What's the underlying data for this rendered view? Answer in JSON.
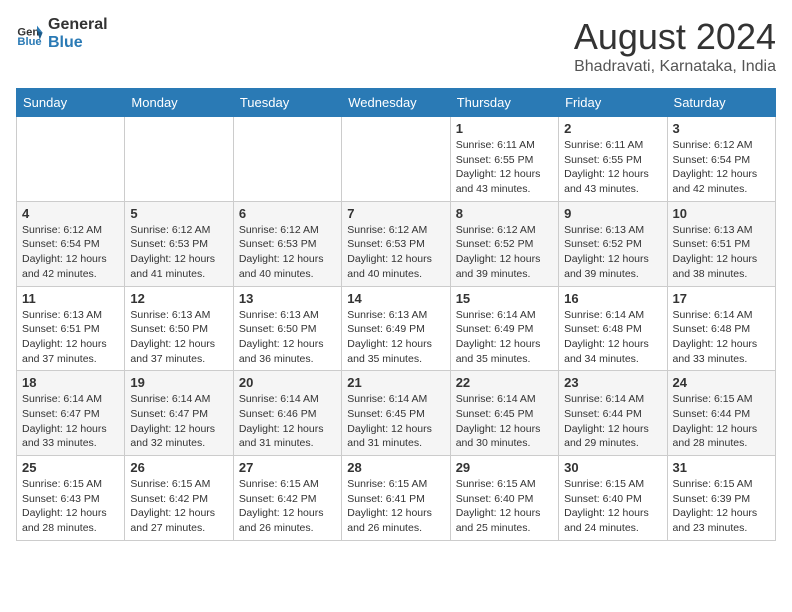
{
  "header": {
    "logo_line1": "General",
    "logo_line2": "Blue",
    "main_title": "August 2024",
    "subtitle": "Bhadravati, Karnataka, India"
  },
  "days_of_week": [
    "Sunday",
    "Monday",
    "Tuesday",
    "Wednesday",
    "Thursday",
    "Friday",
    "Saturday"
  ],
  "weeks": [
    [
      {
        "day": "",
        "info": ""
      },
      {
        "day": "",
        "info": ""
      },
      {
        "day": "",
        "info": ""
      },
      {
        "day": "",
        "info": ""
      },
      {
        "day": "1",
        "info": "Sunrise: 6:11 AM\nSunset: 6:55 PM\nDaylight: 12 hours\nand 43 minutes."
      },
      {
        "day": "2",
        "info": "Sunrise: 6:11 AM\nSunset: 6:55 PM\nDaylight: 12 hours\nand 43 minutes."
      },
      {
        "day": "3",
        "info": "Sunrise: 6:12 AM\nSunset: 6:54 PM\nDaylight: 12 hours\nand 42 minutes."
      }
    ],
    [
      {
        "day": "4",
        "info": "Sunrise: 6:12 AM\nSunset: 6:54 PM\nDaylight: 12 hours\nand 42 minutes."
      },
      {
        "day": "5",
        "info": "Sunrise: 6:12 AM\nSunset: 6:53 PM\nDaylight: 12 hours\nand 41 minutes."
      },
      {
        "day": "6",
        "info": "Sunrise: 6:12 AM\nSunset: 6:53 PM\nDaylight: 12 hours\nand 40 minutes."
      },
      {
        "day": "7",
        "info": "Sunrise: 6:12 AM\nSunset: 6:53 PM\nDaylight: 12 hours\nand 40 minutes."
      },
      {
        "day": "8",
        "info": "Sunrise: 6:12 AM\nSunset: 6:52 PM\nDaylight: 12 hours\nand 39 minutes."
      },
      {
        "day": "9",
        "info": "Sunrise: 6:13 AM\nSunset: 6:52 PM\nDaylight: 12 hours\nand 39 minutes."
      },
      {
        "day": "10",
        "info": "Sunrise: 6:13 AM\nSunset: 6:51 PM\nDaylight: 12 hours\nand 38 minutes."
      }
    ],
    [
      {
        "day": "11",
        "info": "Sunrise: 6:13 AM\nSunset: 6:51 PM\nDaylight: 12 hours\nand 37 minutes."
      },
      {
        "day": "12",
        "info": "Sunrise: 6:13 AM\nSunset: 6:50 PM\nDaylight: 12 hours\nand 37 minutes."
      },
      {
        "day": "13",
        "info": "Sunrise: 6:13 AM\nSunset: 6:50 PM\nDaylight: 12 hours\nand 36 minutes."
      },
      {
        "day": "14",
        "info": "Sunrise: 6:13 AM\nSunset: 6:49 PM\nDaylight: 12 hours\nand 35 minutes."
      },
      {
        "day": "15",
        "info": "Sunrise: 6:14 AM\nSunset: 6:49 PM\nDaylight: 12 hours\nand 35 minutes."
      },
      {
        "day": "16",
        "info": "Sunrise: 6:14 AM\nSunset: 6:48 PM\nDaylight: 12 hours\nand 34 minutes."
      },
      {
        "day": "17",
        "info": "Sunrise: 6:14 AM\nSunset: 6:48 PM\nDaylight: 12 hours\nand 33 minutes."
      }
    ],
    [
      {
        "day": "18",
        "info": "Sunrise: 6:14 AM\nSunset: 6:47 PM\nDaylight: 12 hours\nand 33 minutes."
      },
      {
        "day": "19",
        "info": "Sunrise: 6:14 AM\nSunset: 6:47 PM\nDaylight: 12 hours\nand 32 minutes."
      },
      {
        "day": "20",
        "info": "Sunrise: 6:14 AM\nSunset: 6:46 PM\nDaylight: 12 hours\nand 31 minutes."
      },
      {
        "day": "21",
        "info": "Sunrise: 6:14 AM\nSunset: 6:45 PM\nDaylight: 12 hours\nand 31 minutes."
      },
      {
        "day": "22",
        "info": "Sunrise: 6:14 AM\nSunset: 6:45 PM\nDaylight: 12 hours\nand 30 minutes."
      },
      {
        "day": "23",
        "info": "Sunrise: 6:14 AM\nSunset: 6:44 PM\nDaylight: 12 hours\nand 29 minutes."
      },
      {
        "day": "24",
        "info": "Sunrise: 6:15 AM\nSunset: 6:44 PM\nDaylight: 12 hours\nand 28 minutes."
      }
    ],
    [
      {
        "day": "25",
        "info": "Sunrise: 6:15 AM\nSunset: 6:43 PM\nDaylight: 12 hours\nand 28 minutes."
      },
      {
        "day": "26",
        "info": "Sunrise: 6:15 AM\nSunset: 6:42 PM\nDaylight: 12 hours\nand 27 minutes."
      },
      {
        "day": "27",
        "info": "Sunrise: 6:15 AM\nSunset: 6:42 PM\nDaylight: 12 hours\nand 26 minutes."
      },
      {
        "day": "28",
        "info": "Sunrise: 6:15 AM\nSunset: 6:41 PM\nDaylight: 12 hours\nand 26 minutes."
      },
      {
        "day": "29",
        "info": "Sunrise: 6:15 AM\nSunset: 6:40 PM\nDaylight: 12 hours\nand 25 minutes."
      },
      {
        "day": "30",
        "info": "Sunrise: 6:15 AM\nSunset: 6:40 PM\nDaylight: 12 hours\nand 24 minutes."
      },
      {
        "day": "31",
        "info": "Sunrise: 6:15 AM\nSunset: 6:39 PM\nDaylight: 12 hours\nand 23 minutes."
      }
    ]
  ]
}
